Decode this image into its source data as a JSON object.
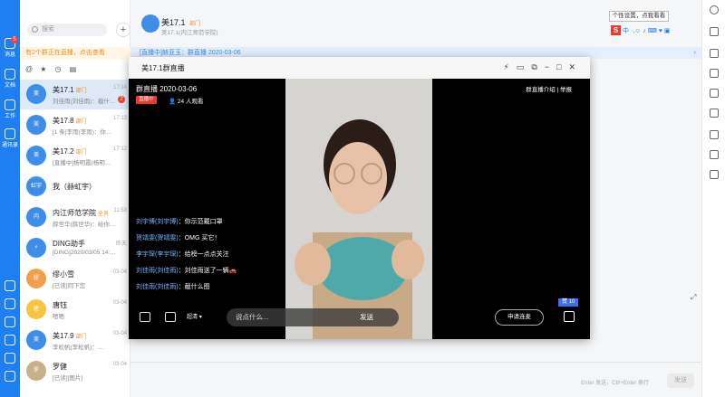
{
  "nav": {
    "items": [
      {
        "label": "消息",
        "badge": "5"
      },
      {
        "label": "文档"
      },
      {
        "label": "工作"
      },
      {
        "label": "通讯录"
      }
    ]
  },
  "search": {
    "placeholder": "搜索"
  },
  "live_notice": "有2个群正在直播，点击查看",
  "chats": [
    {
      "avatar": "美",
      "name": "美17.1",
      "tag": "部门",
      "msg": "刘佳雨(刘佳雨)：截什…",
      "time": "17:14",
      "badge": "2"
    },
    {
      "avatar": "美",
      "name": "美17.8",
      "tag": "部门",
      "msg": "[1 条]李雨(李雨)：你…",
      "time": "17:13",
      "badge": ""
    },
    {
      "avatar": "美",
      "name": "美17.2",
      "tag": "部门",
      "msg": "[直播中]杨明霞(杨明…",
      "time": "17:12",
      "badge": ""
    },
    {
      "avatar": "虹宇",
      "name": "我（赫虹宇）",
      "tag": "",
      "msg": "",
      "time": "",
      "badge": ""
    },
    {
      "avatar": "内",
      "name": "内江师范学院",
      "tag": "全员",
      "msg": "薛世华(薛世华)：给你…",
      "time": "11:53",
      "badge": ""
    },
    {
      "avatar": "⚡",
      "name": "DING助手",
      "tag": "",
      "msg": "[DING]2020/03/05 14:…",
      "time": "昨天",
      "badge": ""
    },
    {
      "avatar": "缪",
      "name": "缪小雪",
      "tag": "",
      "msg": "[已读]同下您",
      "time": "03-04",
      "badge": ""
    },
    {
      "avatar": "唐",
      "name": "唐钰",
      "tag": "",
      "msg": "嗯嗯",
      "time": "03-04",
      "badge": ""
    },
    {
      "avatar": "美",
      "name": "美17.9",
      "tag": "部门",
      "msg": "李松帆(李松帆)：…",
      "time": "03-04",
      "badge": ""
    },
    {
      "avatar": "罗",
      "name": "罗健",
      "tag": "",
      "msg": "[已读][图片]",
      "time": "03-04",
      "badge": ""
    }
  ],
  "header": {
    "title": "美17.1",
    "tag": "部门",
    "subtitle": "美17.1(内江师范学院)"
  },
  "live_banner": "[直播中]赫亚玉：群直播 2020-03-06",
  "composer": {
    "hint": "Enter 发送，Ctrl+Enter 换行",
    "send": "发送"
  },
  "tooltip": "个性设置，点我看看",
  "ime": {
    "logo": "S",
    "mode": "中"
  },
  "live_window": {
    "title": "美17.1群直播",
    "stream_title": "群直播 2020-03-06",
    "status": "直播中",
    "viewers": "24 人观看",
    "links": [
      "群直播介绍",
      "举报"
    ],
    "comments": [
      {
        "user": "刘宇博(刘宇博)",
        "text": "：你示范戴口罩"
      },
      {
        "user": "贺靖雯(贺靖雯)",
        "text": "：OMG 买它！"
      },
      {
        "user": "李宇琛(李宇琛)",
        "text": "：给榜一点点关注"
      },
      {
        "user": "刘佳雨(刘佳雨)",
        "text": "：刘佳雨送了一辆🚗"
      },
      {
        "user": "刘佳雨(刘佳雨)",
        "text": "：截什么图"
      }
    ],
    "likes": "赞 10",
    "quality": "超清",
    "input_placeholder": "说点什么...",
    "send": "发送",
    "connect": "申请连麦"
  },
  "colors": {
    "accent": "#1e7ff0",
    "live_red": "#e83c2e",
    "notice_orange": "#f08c1a"
  }
}
